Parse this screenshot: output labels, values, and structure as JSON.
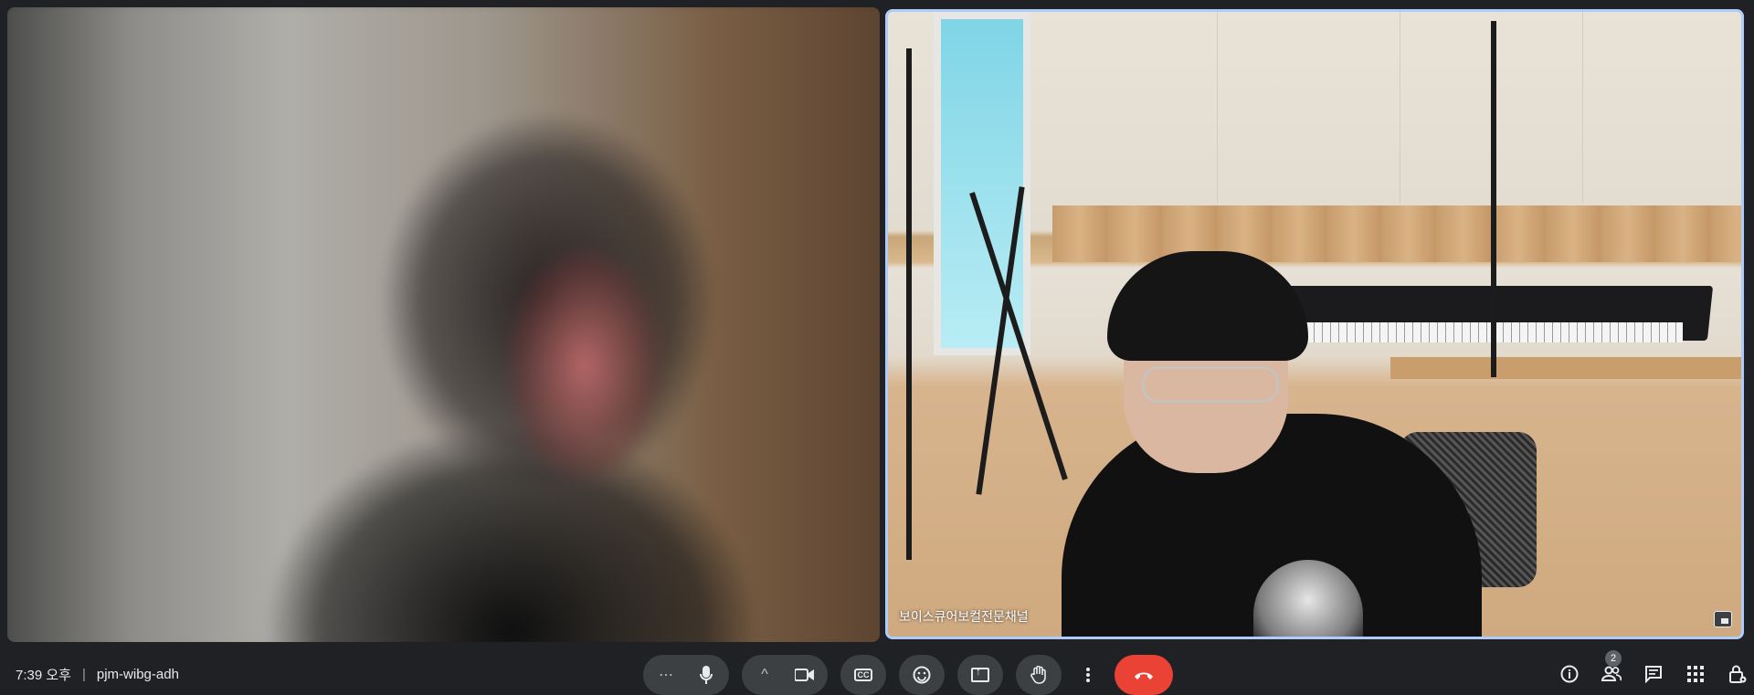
{
  "meeting": {
    "time": "7:39 오후",
    "code": "pjm-wibg-adh"
  },
  "tiles": {
    "right_name": "보이스큐어보컬전문채널"
  },
  "controls": {
    "more_dots": "⋯",
    "mic_icon": "mic-icon",
    "camera_icon": "video-camera-icon",
    "captions_icon": "closed-captions-icon",
    "emoji_icon": "emoji-icon",
    "present_icon": "present-screen-icon",
    "raise_hand_icon": "raise-hand-icon",
    "more_options_icon": "more-vert-icon",
    "end_call_icon": "end-call-icon",
    "chevron_up": "^",
    "cc_label": "CC"
  },
  "side_panel": {
    "people_count": "2",
    "icons": [
      "info-icon",
      "people-icon",
      "chat-icon",
      "activities-icon",
      "host-controls-icon"
    ]
  },
  "colors": {
    "background": "#202124",
    "button": "#3c4043",
    "end_call": "#ea4335",
    "active_speaker_border": "#aecbfa"
  }
}
